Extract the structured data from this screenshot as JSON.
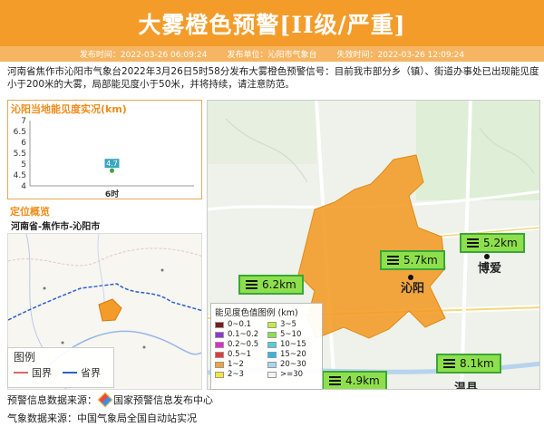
{
  "header": {
    "title": "大雾橙色预警[II级/严重]",
    "issue_time": "发布时间：2022-03-26 06:09:24",
    "issuer": "发布单位：沁阳市气象台",
    "expire_time": "失效时间：2022-03-26 12:09:24"
  },
  "description": "河南省焦作市沁阳市气象台2022年3月26日5时58分发布大雾橙色预警信号：目前我市部分乡（镇）、街道办事处已出现能见度小于200米的大雾，局部能见度小于50米，并将持续，请注意防范。",
  "visibility_panel": {
    "title": "沁阳当地能见度实况(km)"
  },
  "chart_data": {
    "type": "line",
    "categories": [
      "6时"
    ],
    "values": [
      4.7
    ],
    "yticks": [
      4,
      4.5,
      5,
      5.5,
      6,
      6.5,
      7
    ],
    "ylim": [
      4,
      7
    ],
    "data_label": "4.7"
  },
  "location_panel": {
    "title": "定位概览",
    "subtitle": "河南省-焦作市-沁阳市",
    "legend_title": "图例",
    "legend_items": [
      "国界",
      "省界"
    ]
  },
  "map": {
    "stations": [
      "5.7km",
      "5.2km",
      "6.2km",
      "8.1km",
      "4.9km"
    ],
    "cities": [
      "沁阳",
      "博爱",
      "温县"
    ],
    "color_legend": {
      "title": "能见度色值图例 (km)",
      "items": [
        {
          "label": "0~0.1",
          "color": "#7b1a1a"
        },
        {
          "label": "3~5",
          "color": "#c8ea3b"
        },
        {
          "label": "0.1~0.2",
          "color": "#8a3bd6"
        },
        {
          "label": "5~10",
          "color": "#8de04b"
        },
        {
          "label": "0.2~0.5",
          "color": "#e02bd0"
        },
        {
          "label": "10~15",
          "color": "#4fd1d9"
        },
        {
          "label": "0.5~1",
          "color": "#e63a3a"
        },
        {
          "label": "15~20",
          "color": "#2fb8e6"
        },
        {
          "label": "1~2",
          "color": "#f3a23a"
        },
        {
          "label": "20~30",
          "color": "#a7d6ef"
        },
        {
          "label": "2~3",
          "color": "#f3e63a"
        },
        {
          "label": ">=30",
          "color": "#f4f4f4"
        }
      ]
    },
    "fog_color": "#f39c2a"
  },
  "footer": {
    "warning_source_label": "预警信息数据来源：",
    "warning_source": "国家预警信息发布中心",
    "weather_source": "气象数据来源：中国气象局全国自动站实况"
  }
}
